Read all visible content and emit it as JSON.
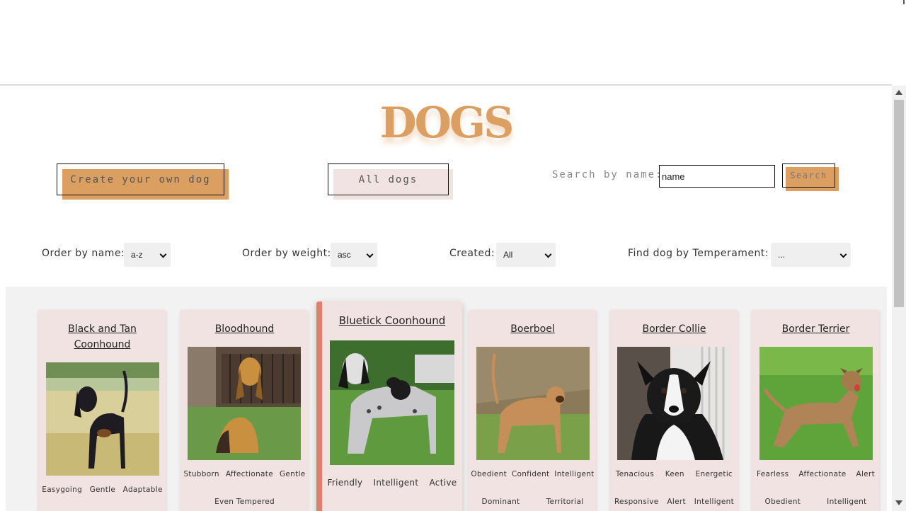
{
  "header": {
    "title": "DOGS"
  },
  "buttons": {
    "create_label": "Create your own dog",
    "all_label": "All dogs",
    "search_label": "Search"
  },
  "search": {
    "label": "Search by name:",
    "value": "name"
  },
  "filters": {
    "order_name_label": "Order by name:",
    "order_name_value": "a-z",
    "order_weight_label": "Order by weight:",
    "order_weight_value": "asc",
    "created_label": "Created:",
    "created_value": "All",
    "temperament_label": "Find dog by Temperament:",
    "temperament_value": "..."
  },
  "colors": {
    "accent": "#dc9f62",
    "card": "#f0e3e1",
    "card_highlight": "#e0806a"
  },
  "cards": [
    {
      "name": "Black and Tan Coonhound",
      "temperaments": [
        "Easygoing",
        "Gentle",
        "Adaptable"
      ]
    },
    {
      "name": "Bloodhound",
      "temperaments": [
        "Stubborn",
        "Affectionate",
        "Gentle",
        "Even Tempered"
      ]
    },
    {
      "name": "Bluetick Coonhound",
      "temperaments": [
        "Friendly",
        "Intelligent",
        "Active"
      ]
    },
    {
      "name": "Boerboel",
      "temperaments": [
        "Obedient",
        "Confident",
        "Intelligent",
        "Dominant",
        "Territorial"
      ]
    },
    {
      "name": "Border Collie",
      "temperaments": [
        "Tenacious",
        "Keen",
        "Energetic",
        "Responsive",
        "Alert",
        "Intelligent"
      ]
    },
    {
      "name": "Border Terrier",
      "temperaments": [
        "Fearless",
        "Affectionate",
        "Alert",
        "Obedient",
        "Intelligent"
      ]
    }
  ]
}
